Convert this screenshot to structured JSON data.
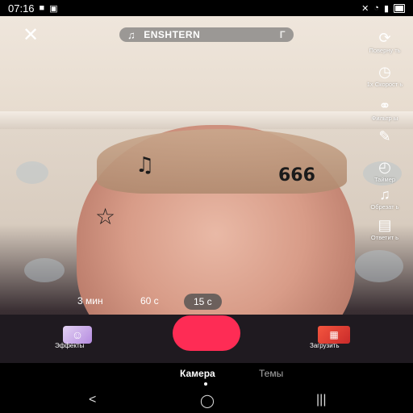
{
  "status": {
    "time": "07:16"
  },
  "top": {
    "sound_title": "ENSHTERN",
    "sound_tail": "Г"
  },
  "right_tools": [
    {
      "label": "Поверну ть",
      "icon": "flip-camera-icon"
    },
    {
      "label": "1x Скорост ь",
      "icon": "speed-icon"
    },
    {
      "label": "Фильтр ы",
      "icon": "filters-icon"
    },
    {
      "label": "",
      "icon": "beauty-icon"
    },
    {
      "label": "Таймер",
      "icon": "timer-icon"
    },
    {
      "label": "Обрезат ь",
      "icon": "trim-sound-icon"
    },
    {
      "label": "Ответит ь",
      "icon": "reply-icon"
    }
  ],
  "durations": [
    {
      "label": "3 мин"
    },
    {
      "label": "60 с"
    },
    {
      "label": "15 с",
      "selected": true
    }
  ],
  "bottom": {
    "effects_label": "Эффекты",
    "upload_label": "Загрузить"
  },
  "modes": {
    "camera": "Камера",
    "themes": "Темы"
  },
  "colors": {
    "record": "#fe2c55",
    "pill": "#787878"
  },
  "tattoos": {
    "forehead_right": "666"
  }
}
